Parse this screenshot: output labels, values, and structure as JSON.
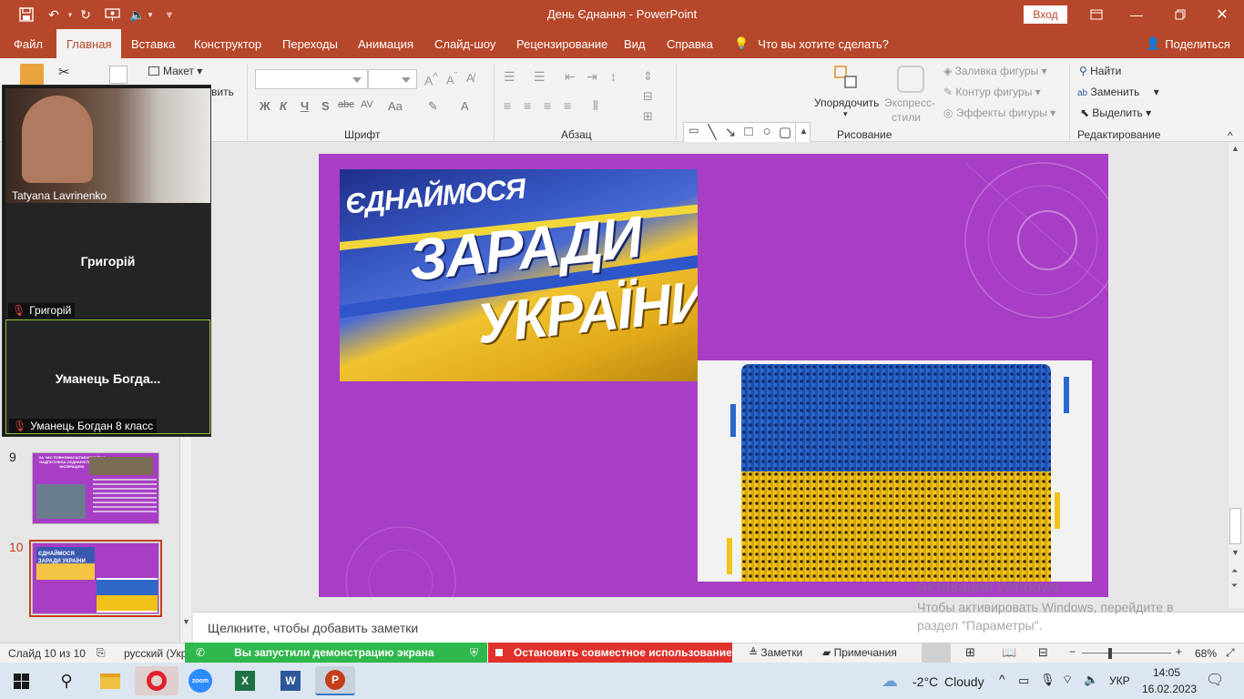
{
  "window": {
    "title": "День Єднання  -  PowerPoint",
    "signin": "Вход"
  },
  "tabs": [
    "Файл",
    "Главная",
    "Вставка",
    "Конструктор",
    "Переходы",
    "Анимация",
    "Слайд-шоу",
    "Рецензирование",
    "Вид",
    "Справка"
  ],
  "active_tab": "Главная",
  "tellme": "Что вы хотите сделать?",
  "share": "Поделиться",
  "ribbon": {
    "clipboard": {
      "layout": "Макет",
      "partial_label": "вить"
    },
    "font": {
      "label": "Шрифт",
      "bold": "Ж",
      "italic": "К",
      "underline": "Ч",
      "shadow": "S",
      "strike": "abc",
      "spacing": "AV",
      "case": "Aa",
      "color": "A"
    },
    "paragraph": {
      "label": "Абзац"
    },
    "drawing": {
      "label": "Рисование",
      "arrange": "Упорядочить",
      "quick_styles_1": "Экспресс-",
      "quick_styles_2": "стили",
      "fill": "Заливка фигуры",
      "outline": "Контур фигуры",
      "effects": "Эффекты фигуры"
    },
    "editing": {
      "label": "Редактирование",
      "find": "Найти",
      "replace": "Заменить",
      "select": "Выделить"
    }
  },
  "thumbnails": [
    {
      "num": "9",
      "title": "ЗА ЧАС ПОВНОМАСШТАБНОЇ ВІЙНИ НАДПОТУЖНА СЄДНАНІСТЬ СТАЛО ІНСПІРАЦІЄЮ"
    },
    {
      "num": "10",
      "title": "ЄДНАЙМОСЯ ЗАРАДИ УКРАЇНИ"
    }
  ],
  "slide": {
    "banner_line1": "ЄДНАЙМОСЯ",
    "banner_line2": "ЗАРАДИ",
    "banner_line3": "УКРАЇНИ"
  },
  "notes_placeholder": "Щелкните, чтобы добавить заметки",
  "activation": {
    "title": "Активация Windows",
    "text": "Чтобы активировать Windows, перейдите в раздел \"Параметры\"."
  },
  "status": {
    "slide": "Слайд 10 из 10",
    "lang": "русский (Укр",
    "notes": "Заметки",
    "comments": "Примечания",
    "zoom": "68%"
  },
  "zoom_share": {
    "sharing": "Вы запустили демонстрацию экрана",
    "stop": "Остановить совместное использование"
  },
  "participants": [
    {
      "name": "Tatyana Lavrinenko",
      "video": true
    },
    {
      "name": "Григорій",
      "label": "Григорій"
    },
    {
      "name": "Уманець  Богда...",
      "label": "Уманець Богдан 8 класс"
    }
  ],
  "taskbar": {
    "weather_temp": "-2°C",
    "weather_text": "Cloudy",
    "lang": "УКР",
    "time": "14:05",
    "date": "16.02.2023"
  },
  "colors": {
    "accent": "#b7472a",
    "slide_bg": "#a83ec5"
  }
}
